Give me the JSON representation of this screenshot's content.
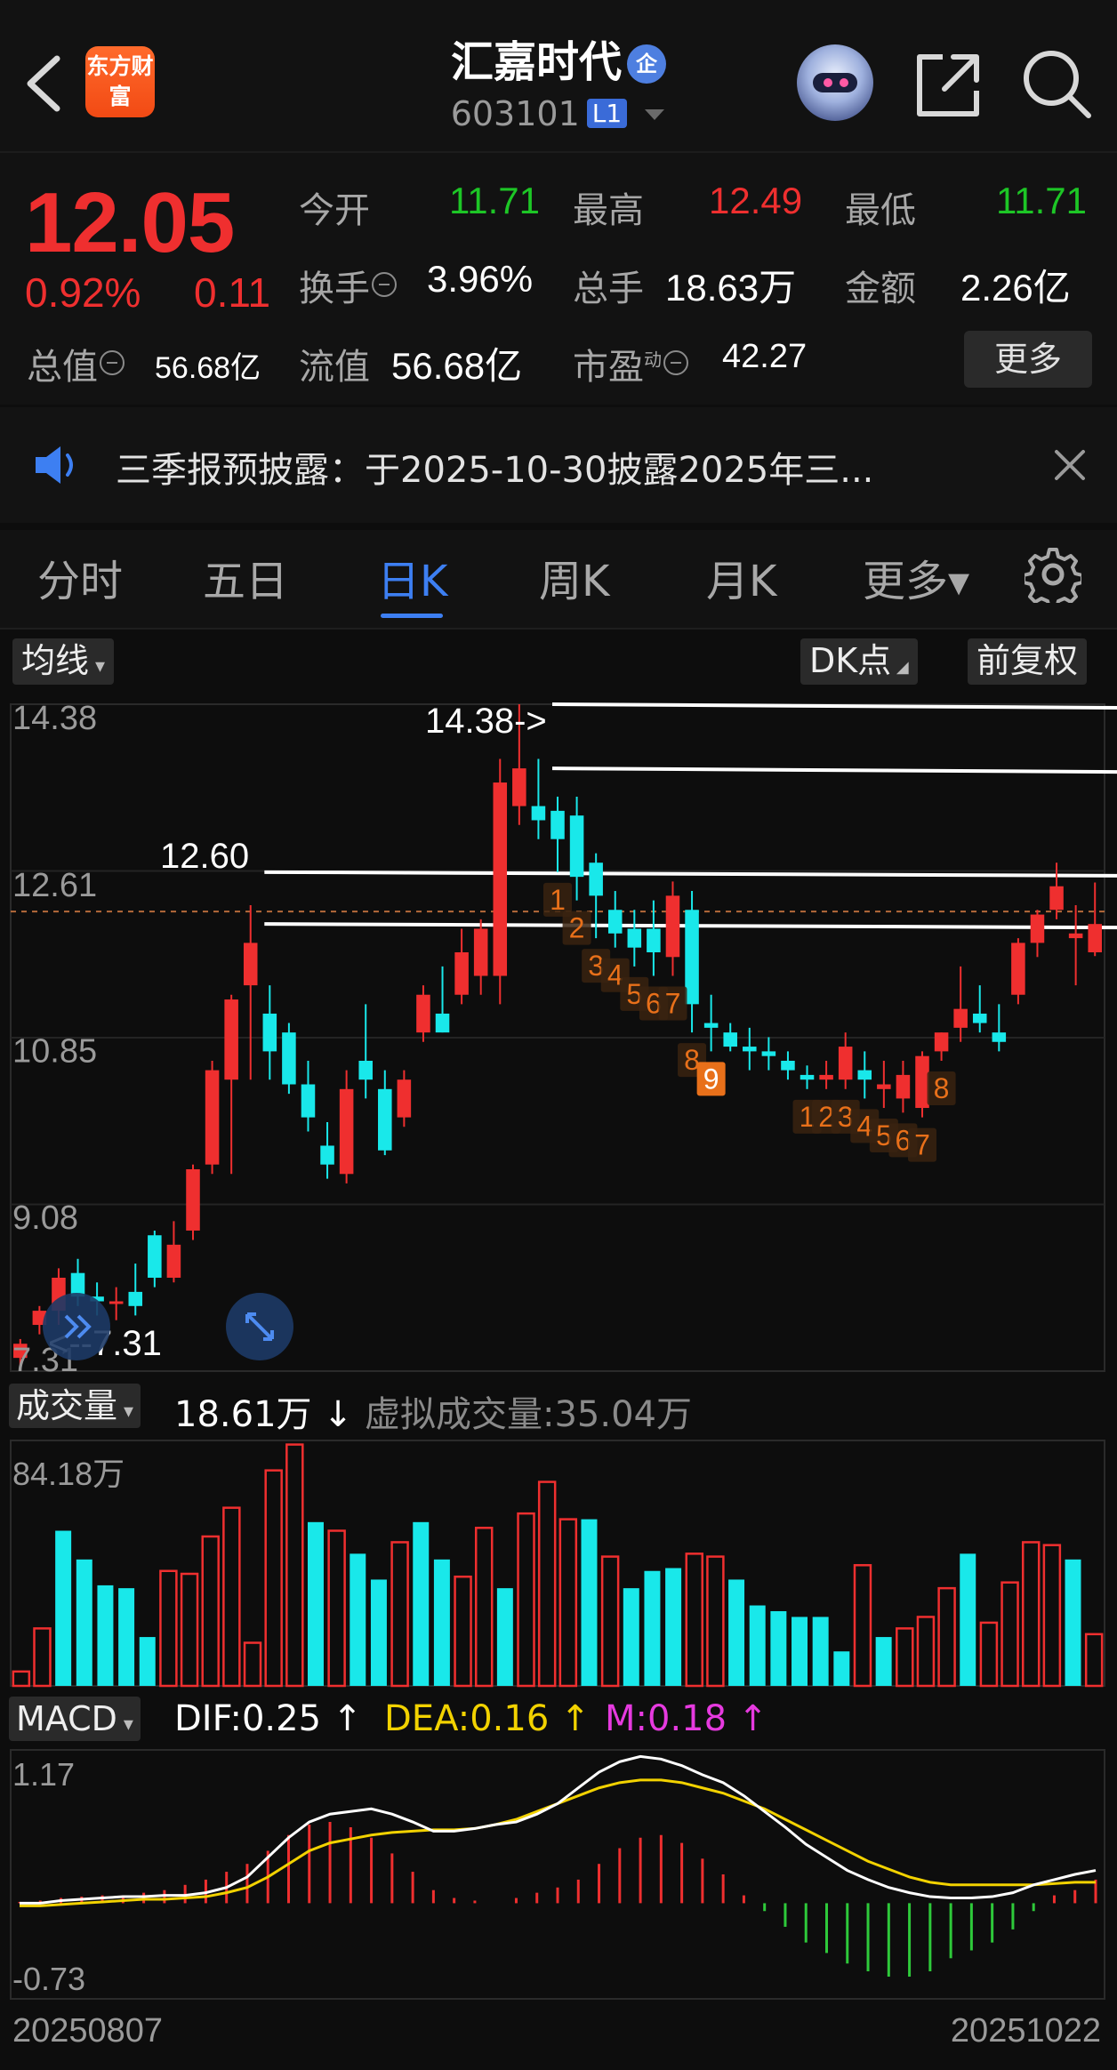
{
  "header": {
    "app_logo_text": "东方财富",
    "stock_name": "汇嘉时代",
    "name_badge": "企",
    "code": "603101",
    "level": "L1"
  },
  "quote": {
    "price": "12.05",
    "change_pct": "0.92%",
    "change": "0.11",
    "open_label": "今开",
    "open": "11.71",
    "high_label": "最高",
    "high": "12.49",
    "low_label": "最低",
    "low": "11.71",
    "turnover_label": "换手",
    "turnover": "3.96%",
    "volume_label": "总手",
    "volume": "18.63万",
    "amount_label": "金额",
    "amount": "2.26亿",
    "mktcap_label": "总值",
    "mktcap": "56.68亿",
    "float_label": "流值",
    "float_cap": "56.68亿",
    "pe_label": "市盈",
    "pe_sup": "动",
    "pe": "42.27",
    "more_label": "更多"
  },
  "notice": {
    "text": "三季报预披露：于2025-10-30披露2025年三..."
  },
  "tabs": [
    {
      "label": "分时"
    },
    {
      "label": "五日"
    },
    {
      "label": "日K"
    },
    {
      "label": "周K"
    },
    {
      "label": "月K"
    },
    {
      "label": "更多▾"
    }
  ],
  "chart_controls": {
    "ma": "均线",
    "dk": "DK点",
    "adjust": "前复权"
  },
  "colors": {
    "up": "#ef2f2f",
    "down": "#19e8ea",
    "dif": "#ffffff",
    "dea": "#f2d200",
    "m": "#e63adf",
    "td": "#e8701a",
    "accent": "#3d7ff2"
  },
  "chart_data": [
    {
      "type": "candlestick",
      "ylim": [
        7.31,
        14.38
      ],
      "y_ticks": [
        "14.38",
        "12.61",
        "10.85",
        "9.08",
        "7.31"
      ],
      "annotations": {
        "high": "14.38->",
        "mid": "12.60",
        "low": "<--7.31"
      },
      "candles": [
        {
          "o": 7.45,
          "h": 7.65,
          "l": 7.31,
          "c": 7.6
        },
        {
          "o": 7.8,
          "h": 8.0,
          "l": 7.7,
          "c": 7.95
        },
        {
          "o": 7.95,
          "h": 8.4,
          "l": 7.8,
          "c": 8.3
        },
        {
          "o": 8.35,
          "h": 8.5,
          "l": 8.0,
          "c": 8.1
        },
        {
          "o": 8.1,
          "h": 8.25,
          "l": 7.9,
          "c": 8.05
        },
        {
          "o": 8.05,
          "h": 8.2,
          "l": 7.85,
          "c": 8.05
        },
        {
          "o": 8.15,
          "h": 8.45,
          "l": 7.9,
          "c": 8.0
        },
        {
          "o": 8.75,
          "h": 8.8,
          "l": 8.2,
          "c": 8.3
        },
        {
          "o": 8.3,
          "h": 8.9,
          "l": 8.25,
          "c": 8.65
        },
        {
          "o": 8.8,
          "h": 9.5,
          "l": 8.7,
          "c": 9.45
        },
        {
          "o": 9.5,
          "h": 10.6,
          "l": 9.4,
          "c": 10.5
        },
        {
          "o": 10.4,
          "h": 11.3,
          "l": 9.4,
          "c": 11.25
        },
        {
          "o": 11.4,
          "h": 12.25,
          "l": 10.4,
          "c": 11.85
        },
        {
          "o": 11.1,
          "h": 11.4,
          "l": 10.4,
          "c": 10.7
        },
        {
          "o": 10.9,
          "h": 11.0,
          "l": 10.25,
          "c": 10.35
        },
        {
          "o": 10.35,
          "h": 10.6,
          "l": 9.85,
          "c": 10.0
        },
        {
          "o": 9.7,
          "h": 9.95,
          "l": 9.35,
          "c": 9.5
        },
        {
          "o": 9.4,
          "h": 10.5,
          "l": 9.3,
          "c": 10.3
        },
        {
          "o": 10.6,
          "h": 11.2,
          "l": 10.2,
          "c": 10.4
        },
        {
          "o": 10.3,
          "h": 10.5,
          "l": 9.6,
          "c": 9.65
        },
        {
          "o": 10.0,
          "h": 10.5,
          "l": 9.9,
          "c": 10.4
        },
        {
          "o": 10.9,
          "h": 11.4,
          "l": 10.8,
          "c": 11.3
        },
        {
          "o": 11.1,
          "h": 11.6,
          "l": 10.9,
          "c": 10.9
        },
        {
          "o": 11.3,
          "h": 12.0,
          "l": 11.2,
          "c": 11.75
        },
        {
          "o": 11.5,
          "h": 12.1,
          "l": 11.3,
          "c": 12.0
        },
        {
          "o": 11.5,
          "h": 13.8,
          "l": 11.2,
          "c": 13.55
        },
        {
          "o": 13.3,
          "h": 14.38,
          "l": 13.1,
          "c": 13.7
        },
        {
          "o": 13.3,
          "h": 13.8,
          "l": 12.95,
          "c": 13.15
        },
        {
          "o": 13.25,
          "h": 13.4,
          "l": 12.6,
          "c": 12.95
        },
        {
          "o": 13.2,
          "h": 13.4,
          "l": 12.3,
          "c": 12.55
        },
        {
          "o": 12.7,
          "h": 12.8,
          "l": 11.9,
          "c": 12.35
        },
        {
          "o": 12.2,
          "h": 12.4,
          "l": 11.8,
          "c": 11.95
        },
        {
          "o": 12.0,
          "h": 12.2,
          "l": 11.6,
          "c": 11.8
        },
        {
          "o": 12.0,
          "h": 12.3,
          "l": 11.5,
          "c": 11.75
        },
        {
          "o": 11.7,
          "h": 12.5,
          "l": 11.5,
          "c": 12.35
        },
        {
          "o": 12.2,
          "h": 12.4,
          "l": 10.9,
          "c": 11.2
        },
        {
          "o": 11.0,
          "h": 11.3,
          "l": 10.7,
          "c": 10.95
        },
        {
          "o": 10.9,
          "h": 11.0,
          "l": 10.7,
          "c": 10.75
        },
        {
          "o": 10.75,
          "h": 10.95,
          "l": 10.5,
          "c": 10.7
        },
        {
          "o": 10.7,
          "h": 10.85,
          "l": 10.5,
          "c": 10.65
        },
        {
          "o": 10.6,
          "h": 10.7,
          "l": 10.4,
          "c": 10.5
        },
        {
          "o": 10.45,
          "h": 10.55,
          "l": 10.3,
          "c": 10.4
        },
        {
          "o": 10.4,
          "h": 10.6,
          "l": 10.3,
          "c": 10.45
        },
        {
          "o": 10.4,
          "h": 10.9,
          "l": 10.3,
          "c": 10.75
        },
        {
          "o": 10.5,
          "h": 10.7,
          "l": 10.2,
          "c": 10.4
        },
        {
          "o": 10.3,
          "h": 10.6,
          "l": 10.1,
          "c": 10.35
        },
        {
          "o": 10.2,
          "h": 10.6,
          "l": 10.05,
          "c": 10.45
        },
        {
          "o": 10.1,
          "h": 10.7,
          "l": 10.0,
          "c": 10.65
        },
        {
          "o": 10.7,
          "h": 10.9,
          "l": 10.6,
          "c": 10.9
        },
        {
          "o": 10.95,
          "h": 11.6,
          "l": 10.8,
          "c": 11.15
        },
        {
          "o": 11.1,
          "h": 11.4,
          "l": 10.9,
          "c": 11.0
        },
        {
          "o": 10.9,
          "h": 11.2,
          "l": 10.7,
          "c": 10.8
        },
        {
          "o": 11.3,
          "h": 11.9,
          "l": 11.2,
          "c": 11.85
        },
        {
          "o": 11.85,
          "h": 12.2,
          "l": 11.7,
          "c": 12.15
        },
        {
          "o": 12.2,
          "h": 12.7,
          "l": 12.1,
          "c": 12.45
        },
        {
          "o": 11.9,
          "h": 12.25,
          "l": 11.4,
          "c": 11.95
        },
        {
          "o": 11.75,
          "h": 12.49,
          "l": 11.71,
          "c": 12.05
        }
      ],
      "td_markers": [
        {
          "n": "1",
          "i": 28
        },
        {
          "n": "2",
          "i": 29
        },
        {
          "n": "3",
          "i": 30
        },
        {
          "n": "4",
          "i": 31
        },
        {
          "n": "5",
          "i": 32
        },
        {
          "n": "6",
          "i": 33
        },
        {
          "n": "7",
          "i": 34
        },
        {
          "n": "8",
          "i": 35
        },
        {
          "n": "9",
          "i": 36
        },
        {
          "n": "1",
          "i": 41
        },
        {
          "n": "2",
          "i": 42
        },
        {
          "n": "3",
          "i": 43
        },
        {
          "n": "4",
          "i": 44
        },
        {
          "n": "5",
          "i": 45
        },
        {
          "n": "6",
          "i": 46
        },
        {
          "n": "7",
          "i": 47
        },
        {
          "n": "8",
          "i": 48
        }
      ],
      "resistance_lines": [
        14.38,
        13.7,
        12.6,
        12.05
      ]
    },
    {
      "type": "bar",
      "title": "成交量",
      "value_label": "18.61万",
      "virtual_label": "虚拟成交量:35.04万",
      "y_tick": "84.18万",
      "ylim": [
        0,
        84.18
      ],
      "values": [
        5,
        20,
        54,
        44,
        35,
        34,
        17,
        40,
        39,
        52,
        62,
        15,
        75,
        84,
        57,
        54,
        46,
        37,
        50,
        57,
        44,
        38,
        55,
        34,
        60,
        71,
        58,
        58,
        45,
        34,
        40,
        41,
        46,
        45,
        37,
        28,
        26,
        24,
        24,
        12,
        42,
        17,
        20,
        24,
        34,
        46,
        22,
        36,
        50,
        49,
        44,
        18
      ],
      "up": [
        1,
        1,
        0,
        0,
        0,
        0,
        0,
        1,
        1,
        1,
        1,
        1,
        1,
        1,
        0,
        1,
        0,
        0,
        1,
        0,
        0,
        1,
        1,
        0,
        1,
        1,
        1,
        0,
        1,
        0,
        0,
        0,
        1,
        1,
        0,
        0,
        0,
        0,
        0,
        0,
        1,
        0,
        1,
        1,
        1,
        0,
        1,
        1,
        1,
        1,
        0,
        1
      ]
    },
    {
      "type": "line",
      "title": "MACD",
      "dif_label": "DIF:0.25",
      "dea_label": "DEA:0.16",
      "m_label": "M:0.18",
      "y_ticks": [
        "1.17",
        "-0.73"
      ],
      "ylim": [
        -0.73,
        1.17
      ],
      "x_labels": [
        "20250807",
        "20251022"
      ],
      "dif": [
        0.0,
        0.0,
        0.02,
        0.03,
        0.04,
        0.05,
        0.05,
        0.06,
        0.06,
        0.08,
        0.12,
        0.2,
        0.35,
        0.5,
        0.62,
        0.68,
        0.7,
        0.72,
        0.68,
        0.62,
        0.55,
        0.55,
        0.57,
        0.6,
        0.62,
        0.68,
        0.76,
        0.88,
        1.0,
        1.08,
        1.12,
        1.1,
        1.05,
        0.98,
        0.92,
        0.82,
        0.7,
        0.58,
        0.45,
        0.35,
        0.25,
        0.18,
        0.12,
        0.08,
        0.05,
        0.04,
        0.04,
        0.05,
        0.08,
        0.14,
        0.18,
        0.22,
        0.25
      ],
      "dea": [
        -0.02,
        -0.02,
        -0.01,
        0.0,
        0.01,
        0.02,
        0.03,
        0.03,
        0.04,
        0.05,
        0.08,
        0.12,
        0.2,
        0.3,
        0.4,
        0.46,
        0.49,
        0.52,
        0.54,
        0.55,
        0.56,
        0.56,
        0.57,
        0.6,
        0.64,
        0.7,
        0.76,
        0.82,
        0.88,
        0.92,
        0.94,
        0.94,
        0.92,
        0.88,
        0.84,
        0.78,
        0.72,
        0.64,
        0.56,
        0.48,
        0.4,
        0.32,
        0.26,
        0.2,
        0.16,
        0.14,
        0.14,
        0.14,
        0.14,
        0.14,
        0.15,
        0.16,
        0.16
      ],
      "m": [
        0.01,
        0.02,
        0.04,
        0.05,
        0.06,
        0.06,
        0.08,
        0.1,
        0.14,
        0.18,
        0.24,
        0.3,
        0.4,
        0.52,
        0.6,
        0.62,
        0.58,
        0.5,
        0.38,
        0.24,
        0.1,
        0.04,
        0.02,
        0.0,
        0.04,
        0.08,
        0.12,
        0.18,
        0.3,
        0.42,
        0.5,
        0.52,
        0.46,
        0.34,
        0.22,
        0.06,
        -0.06,
        -0.18,
        -0.3,
        -0.38,
        -0.46,
        -0.52,
        -0.56,
        -0.56,
        -0.52,
        -0.42,
        -0.36,
        -0.3,
        -0.2,
        -0.06,
        0.06,
        0.1,
        0.18
      ]
    }
  ]
}
